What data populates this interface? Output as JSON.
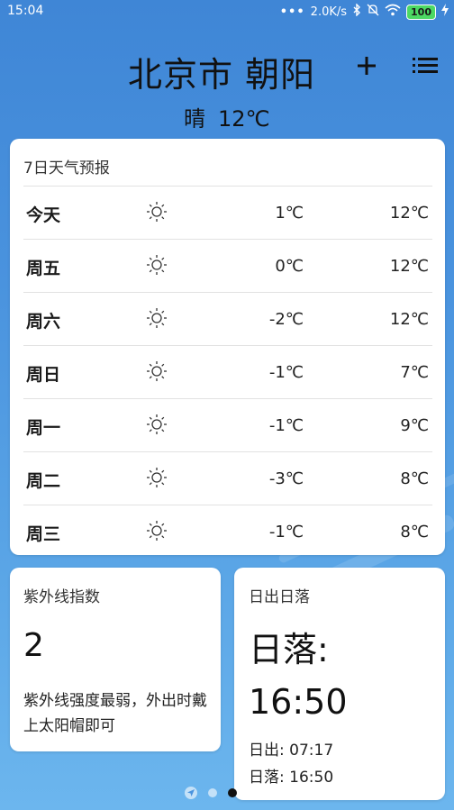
{
  "status_bar": {
    "time": "15:04",
    "network_speed": "2.0K/s",
    "battery": "100"
  },
  "header": {
    "city": "北京市 朝阳",
    "condition": "晴",
    "temperature": "12℃"
  },
  "forecast": {
    "title": "7日天气预报",
    "days": [
      {
        "day": "今天",
        "icon": "sun-icon",
        "low": "1℃",
        "high": "12℃"
      },
      {
        "day": "周五",
        "icon": "sun-icon",
        "low": "0℃",
        "high": "12℃"
      },
      {
        "day": "周六",
        "icon": "sun-icon",
        "low": "-2℃",
        "high": "12℃"
      },
      {
        "day": "周日",
        "icon": "sun-icon",
        "low": "-1℃",
        "high": "7℃"
      },
      {
        "day": "周一",
        "icon": "sun-icon",
        "low": "-1℃",
        "high": "9℃"
      },
      {
        "day": "周二",
        "icon": "sun-icon",
        "low": "-3℃",
        "high": "8℃"
      },
      {
        "day": "周三",
        "icon": "sun-icon",
        "low": "-1℃",
        "high": "8℃"
      }
    ]
  },
  "uv": {
    "title": "紫外线指数",
    "value": "2",
    "description": "紫外线强度最弱，外出时戴上太阳帽即可"
  },
  "sun": {
    "title": "日出日落",
    "sunset_big_label": "日落:",
    "sunset_big_time": "16:50",
    "sunrise_label": "日出:",
    "sunrise_time": "07:17",
    "sunset_label": "日落:",
    "sunset_time": "16:50"
  },
  "pager": {
    "pages": 3,
    "active_index": 2
  },
  "colors": {
    "background_top": "#3f86d6",
    "background_bottom": "#6cb6ee",
    "card": "#ffffff",
    "battery": "#4cd964"
  }
}
